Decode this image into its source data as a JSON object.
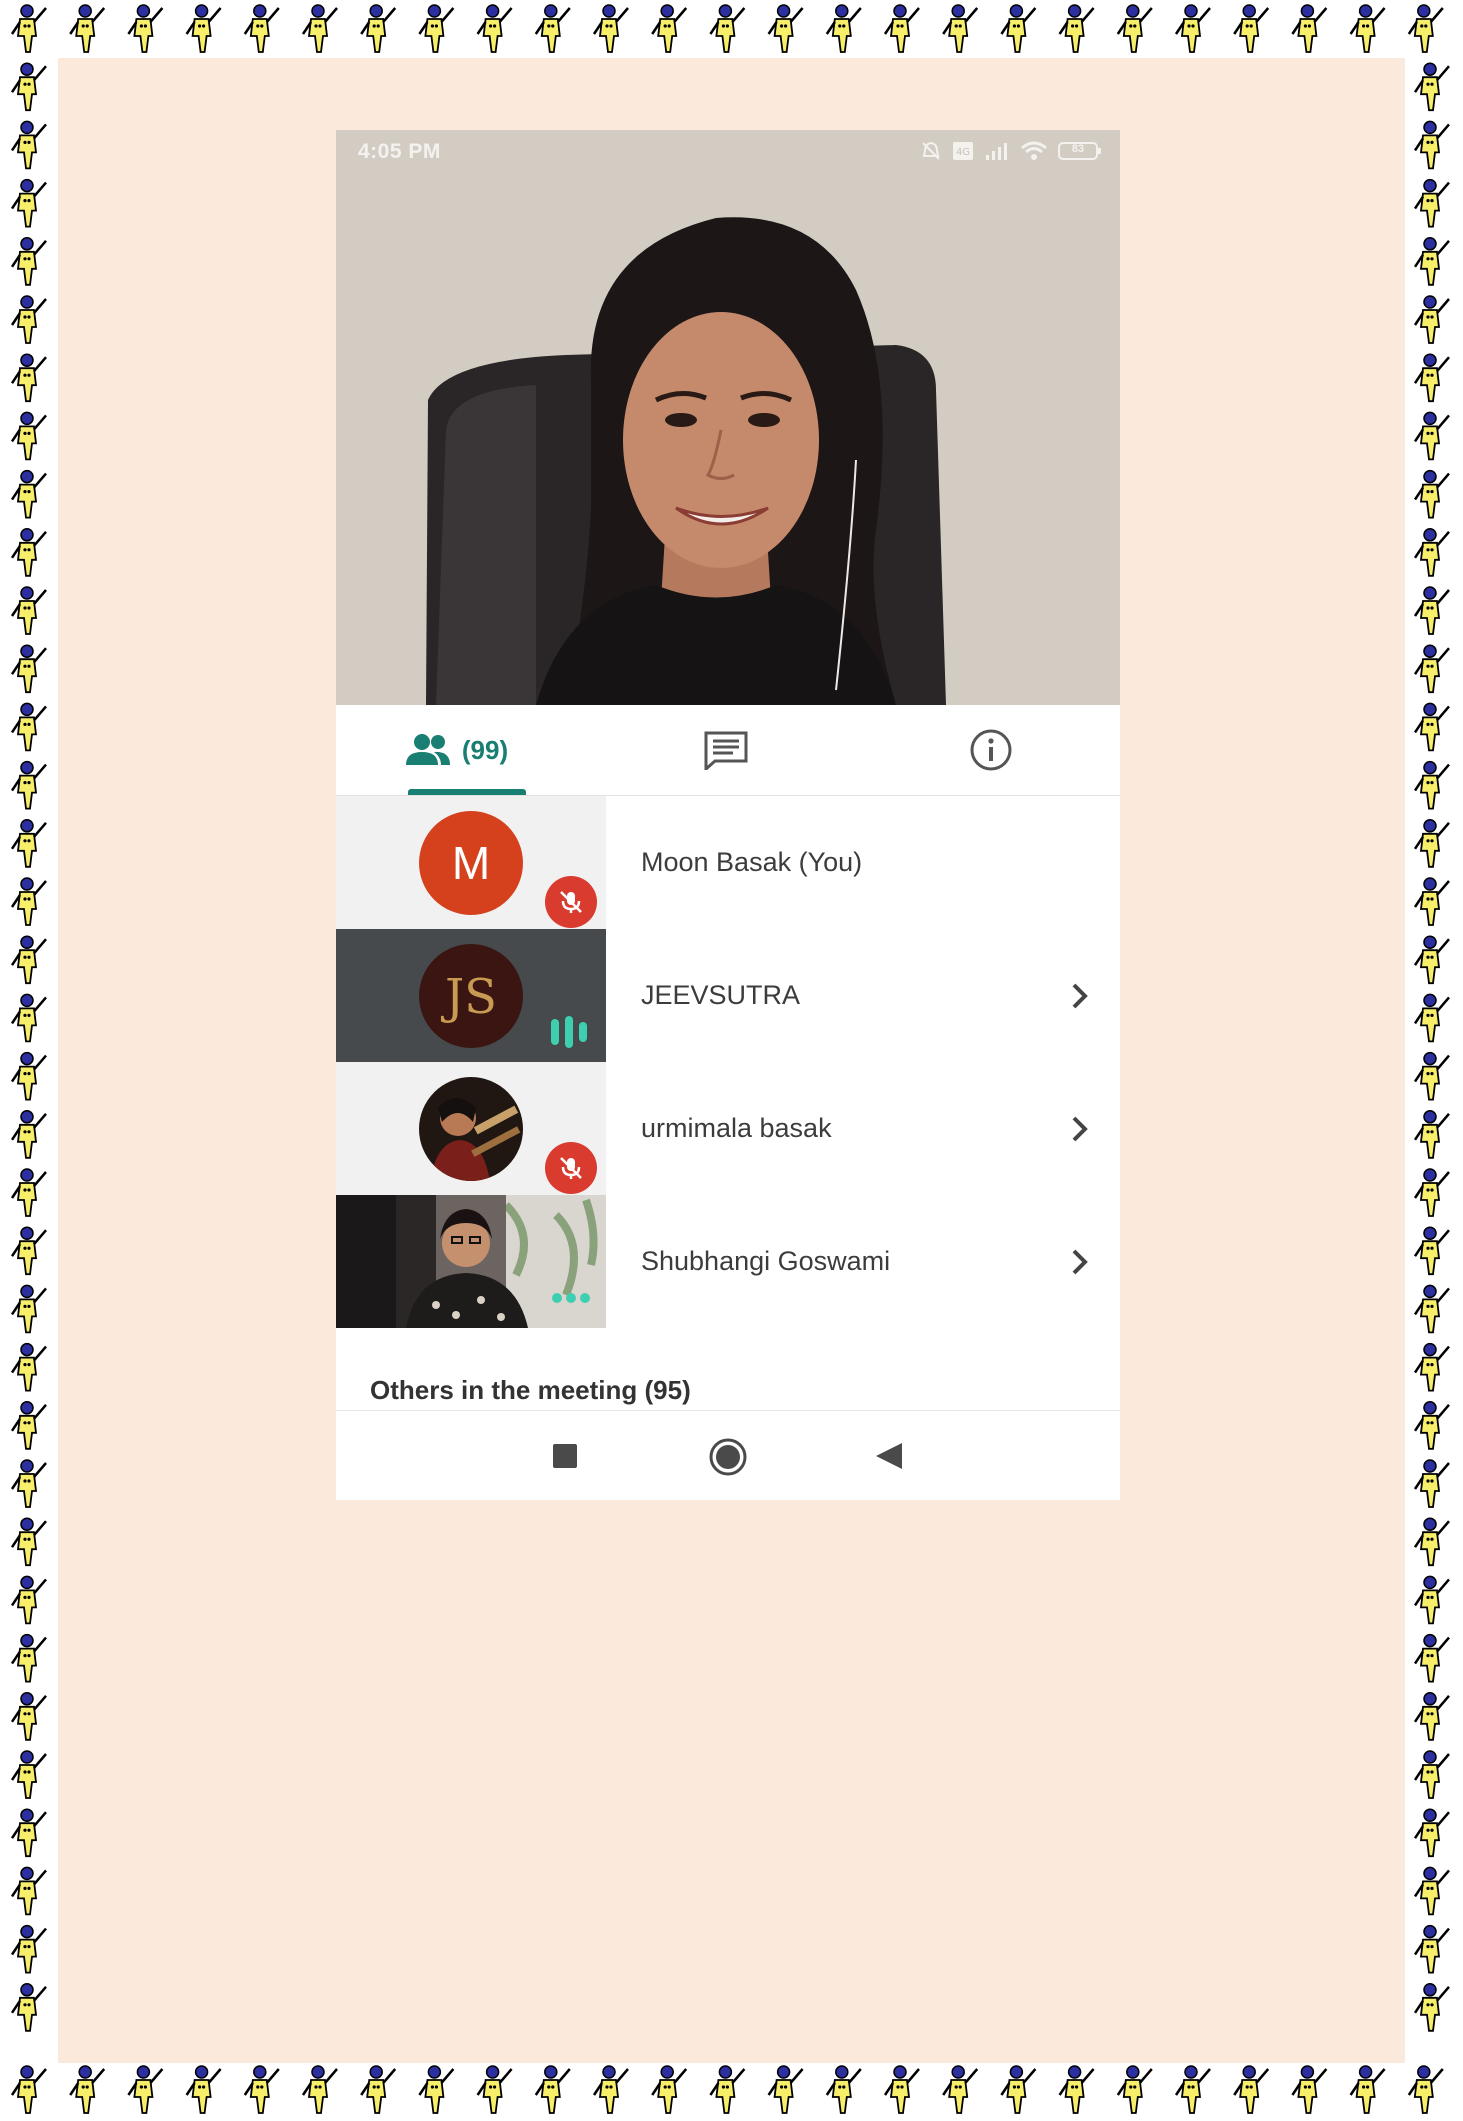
{
  "status_bar": {
    "time": "4:05 PM",
    "battery": "83",
    "icons": [
      "mute-bell-icon",
      "volte-icon",
      "signal-icon",
      "wifi-icon",
      "battery-icon"
    ]
  },
  "tabs": {
    "people_count": "(99)",
    "people_icon": "people-icon",
    "chat_icon": "chat-icon",
    "info_icon": "info-icon",
    "accent_color": "#1a7f73"
  },
  "participants": [
    {
      "name": "Moon Basak (You)",
      "avatar_letter": "M",
      "status": "muted",
      "has_chevron": false
    },
    {
      "name": "JEEVSUTRA",
      "avatar_letter": "",
      "status": "speaking",
      "has_chevron": true
    },
    {
      "name": "urmimala basak",
      "avatar_letter": "",
      "status": "muted",
      "has_chevron": true
    },
    {
      "name": "Shubhangi Goswami",
      "avatar_letter": "",
      "status": "active",
      "has_chevron": true
    }
  ],
  "others_label": "Others in the meeting (95)",
  "nav_buttons": [
    "recents-square-icon",
    "home-circle-icon",
    "back-triangle-icon"
  ],
  "colors": {
    "paper": "#fbe9dc",
    "avatar_m": "#d5401d",
    "mute_red": "#d93b2f",
    "speaking_teal": "#3ecfb1"
  }
}
